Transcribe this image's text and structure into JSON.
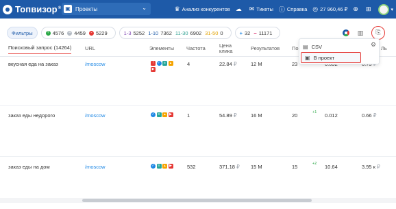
{
  "colors": {
    "topbar": "#1e5aa8",
    "accent_red": "#e53935",
    "link": "#1e88e5",
    "positive": "#29a745"
  },
  "topbar": {
    "logo_text": "Топвизор",
    "logo_reg": "®",
    "project_label": "Проекты",
    "nav": [
      {
        "icon": "crown-icon",
        "label": "Анализ конкурентов"
      },
      {
        "icon": "cloud-sync-icon",
        "label": ""
      },
      {
        "icon": "mail-icon",
        "label": "Тикеты"
      },
      {
        "icon": "help-icon",
        "label": "Справка"
      },
      {
        "icon": "wallet-icon",
        "label": "27 960,46 ₽"
      }
    ]
  },
  "filters": {
    "button_label": "Фильтры",
    "stat_up": "4576",
    "stat_same": "4459",
    "stat_down": "5229",
    "pos_1_3_label": "1-3",
    "pos_1_3": "5252",
    "pos_1_10_label": "1-10",
    "pos_1_10": "7362",
    "pos_11_30_label": "11-30",
    "pos_11_30": "6902",
    "pos_31_50_label": "31-50",
    "pos_31_50": "0",
    "plus_value": "32",
    "minus_value": "11171"
  },
  "export_menu": {
    "csv_label": "CSV",
    "project_label": "В проект"
  },
  "table": {
    "headers": {
      "query": "Поисковый запрос (14264)",
      "url": "URL",
      "elements": "Элементы",
      "frequency": "Частота",
      "cost": "Цена клика",
      "results": "Результатов",
      "position": "По",
      "suffix": "Ль"
    },
    "rows": [
      {
        "query": "вкусная еда на заказ",
        "url": "/moscow",
        "freq": "4",
        "cost": "22.84",
        "currency": "₽",
        "results": "12 M",
        "pos": "23",
        "delta": "",
        "ctr": "0.032",
        "value": "0.73",
        "value_currency": "₽"
      },
      {
        "query": "заказ еды недорого",
        "url": "/moscow",
        "freq": "1",
        "cost": "54.89",
        "currency": "₽",
        "results": "16 M",
        "pos": "20",
        "delta": "+1",
        "ctr": "0.012",
        "value": "0.66",
        "value_currency": "₽"
      },
      {
        "query": "заказ еды на дом",
        "url": "/moscow",
        "freq": "532",
        "cost": "371.18",
        "currency": "₽",
        "results": "15 M",
        "pos": "15",
        "delta": "+2",
        "ctr": "10.64",
        "value": "3.95 к",
        "value_currency": "₽"
      }
    ]
  }
}
